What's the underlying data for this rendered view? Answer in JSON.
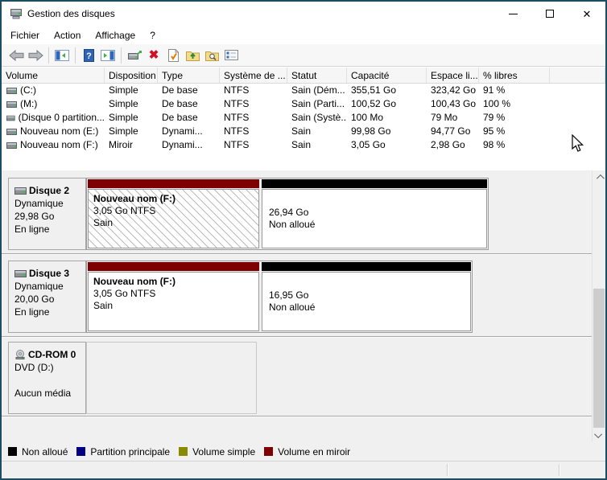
{
  "window": {
    "title": "Gestion des disques"
  },
  "menu": {
    "items": [
      "Fichier",
      "Action",
      "Affichage",
      "?"
    ]
  },
  "toolbar": {
    "icons": [
      "back-icon",
      "forward-icon",
      "show-console-tree-icon",
      "help-icon",
      "show-action-pane-icon",
      "rescan-disks-icon",
      "delete-volume-icon",
      "properties-icon",
      "open-folder-icon",
      "explore-folder-icon",
      "tasks-icon"
    ]
  },
  "volume_table": {
    "columns": [
      "Volume",
      "Disposition",
      "Type",
      "Système de ...",
      "Statut",
      "Capacité",
      "Espace li...",
      "% libres"
    ],
    "rows": [
      {
        "volume": "(C:)",
        "disposition": "Simple",
        "type": "De base",
        "systeme": "NTFS",
        "statut": "Sain (Dém...",
        "capacite": "355,51 Go",
        "espace": "323,42 Go",
        "libres": "91 %"
      },
      {
        "volume": "(M:)",
        "disposition": "Simple",
        "type": "De base",
        "systeme": "NTFS",
        "statut": "Sain (Parti...",
        "capacite": "100,52 Go",
        "espace": "100,43 Go",
        "libres": "100 %"
      },
      {
        "volume": "(Disque 0 partition...",
        "disposition": "Simple",
        "type": "De base",
        "systeme": "NTFS",
        "statut": "Sain (Systè...",
        "capacite": "100 Mo",
        "espace": "79 Mo",
        "libres": "79 %"
      },
      {
        "volume": "Nouveau nom (E:)",
        "disposition": "Simple",
        "type": "Dynami...",
        "systeme": "NTFS",
        "statut": "Sain",
        "capacite": "99,98 Go",
        "espace": "94,77 Go",
        "libres": "95 %"
      },
      {
        "volume": "Nouveau nom (F:)",
        "disposition": "Miroir",
        "type": "Dynami...",
        "systeme": "NTFS",
        "statut": "Sain",
        "capacite": "3,05 Go",
        "espace": "2,98 Go",
        "libres": "98 %"
      }
    ]
  },
  "disks": [
    {
      "name": "Disque 2",
      "kind": "Dynamique",
      "size": "29,98 Go",
      "state": "En ligne",
      "partitions": [
        {
          "label": "Nouveau nom  (F:)",
          "info": "3,05 Go NTFS",
          "health": "Sain",
          "status_color": "#7f0000",
          "selected_hatch": true
        },
        {
          "size": "26,94 Go",
          "kind": "Non alloué",
          "status_color": "#000000"
        }
      ]
    },
    {
      "name": "Disque 3",
      "kind": "Dynamique",
      "size": "20,00 Go",
      "state": "En ligne",
      "partitions": [
        {
          "label": "Nouveau nom  (F:)",
          "info": "3,05 Go NTFS",
          "health": "Sain",
          "status_color": "#7f0000",
          "selected_hatch": false
        },
        {
          "size": "16,95 Go",
          "kind": "Non alloué",
          "status_color": "#000000"
        }
      ]
    },
    {
      "name": "CD-ROM 0",
      "media": "DVD (D:)",
      "state": "Aucun média"
    }
  ],
  "legend": {
    "items": [
      {
        "label": "Non alloué",
        "color": "#000000"
      },
      {
        "label": "Partition principale",
        "color": "#000080"
      },
      {
        "label": "Volume simple",
        "color": "#8a8a00"
      },
      {
        "label": "Volume en miroir",
        "color": "#7f0000"
      }
    ]
  },
  "colors": {
    "window_border": "#1d4d63",
    "pane_background": "#f0f0f0",
    "mirrored_volume": "#7f0000",
    "unallocated": "#000000"
  }
}
